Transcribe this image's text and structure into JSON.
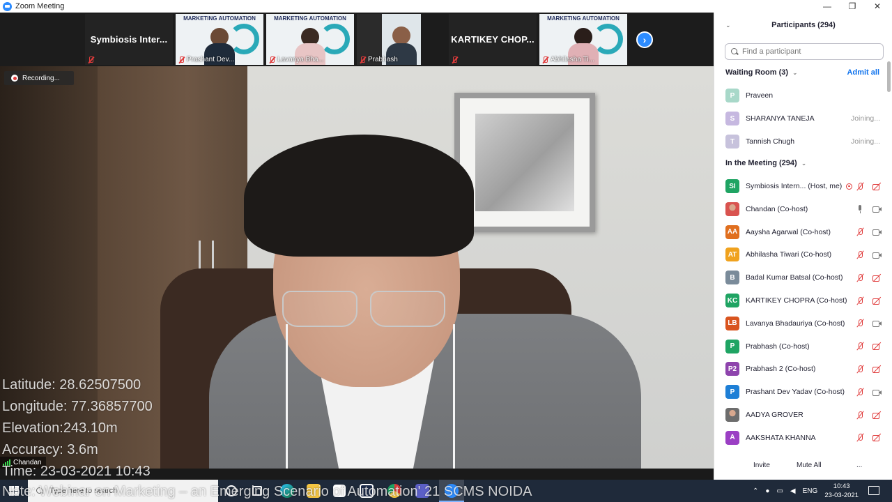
{
  "window": {
    "title": "Zoom Meeting",
    "controls": {
      "minimize": "—",
      "restore": "❐",
      "close": "✕"
    }
  },
  "strip": {
    "tiles": [
      {
        "name": "Symbiosis Inter...",
        "type": "name"
      },
      {
        "name": "Prashant Dev...",
        "type": "video",
        "poster": "MARKETING AUTOMATION"
      },
      {
        "name": "Lavanya Bha...",
        "type": "video",
        "poster": "MARKETING AUTOMATION"
      },
      {
        "name": "Prabhash",
        "type": "video",
        "poster": ""
      },
      {
        "name": "KARTIKEY CHOP...",
        "type": "name"
      },
      {
        "name": "Abhilasha Ti...",
        "type": "video",
        "poster": "MARKETING AUTOMATION"
      }
    ],
    "next_icon": "›"
  },
  "recording": {
    "label": "Recording..."
  },
  "overlay": {
    "latitude": "Latitude: 28.62507500",
    "longitude": "Longitude: 77.36857700",
    "elevation": "Elevation:243.10m",
    "accuracy": "Accuracy: 3.6m",
    "time": "Time: 23-03-2021   10:43",
    "note": "Note: Webinar on Marketing – an Emerging Scenario of Automation' 21 SCMS NOIDA"
  },
  "speaker": {
    "name": "Chandan"
  },
  "panel": {
    "title": "Participants (294)",
    "search_placeholder": "Find a participant",
    "waiting_room": "Waiting Room (3)",
    "admit_all": "Admit all",
    "in_meeting": "In the Meeting (294)",
    "waiting": [
      {
        "initials": "P",
        "name": "Praveen",
        "status": "",
        "color": "#a8d8c9"
      },
      {
        "initials": "S",
        "name": "SHARANYA TANEJA",
        "status": "Joining...",
        "color": "#c6b8e0"
      },
      {
        "initials": "T",
        "name": "Tannish Chugh",
        "status": "Joining...",
        "color": "#c7c2dc"
      }
    ],
    "participants": [
      {
        "initials": "SI",
        "name": "Symbiosis Intern...  (Host, me)",
        "color": "#1fa463",
        "mic": "muted",
        "cam": "off",
        "host": true
      },
      {
        "initials": "",
        "name": "Chandan (Co-host)",
        "color": "#d9534f",
        "mic": "on",
        "cam": "on",
        "photo": true
      },
      {
        "initials": "AA",
        "name": "Aaysha Agarwal (Co-host)",
        "color": "#e06f1f",
        "mic": "muted",
        "cam": "on"
      },
      {
        "initials": "AT",
        "name": "Abhilasha Tiwari (Co-host)",
        "color": "#f0a21e",
        "mic": "muted",
        "cam": "on"
      },
      {
        "initials": "B",
        "name": "Badal Kumar Batsal (Co-host)",
        "color": "#7a8b9a",
        "mic": "muted",
        "cam": "off"
      },
      {
        "initials": "KC",
        "name": "KARTIKEY CHOPRA (Co-host)",
        "color": "#1fa463",
        "mic": "muted",
        "cam": "off"
      },
      {
        "initials": "LB",
        "name": "Lavanya Bhadauriya (Co-host)",
        "color": "#d9541f",
        "mic": "muted",
        "cam": "on"
      },
      {
        "initials": "P",
        "name": "Prabhash (Co-host)",
        "color": "#1fa463",
        "mic": "muted",
        "cam": "off"
      },
      {
        "initials": "P2",
        "name": "Prabhash 2 (Co-host)",
        "color": "#8e44ad",
        "mic": "muted",
        "cam": "off"
      },
      {
        "initials": "P",
        "name": "Prashant Dev Yadav (Co-host)",
        "color": "#1e7fd6",
        "mic": "muted",
        "cam": "on"
      },
      {
        "initials": "",
        "name": "AADYA GROVER",
        "color": "#6d6d6d",
        "mic": "muted",
        "cam": "off",
        "photo": true
      },
      {
        "initials": "A",
        "name": "AAKSHATA KHANNA",
        "color": "#9b3fc4",
        "mic": "muted",
        "cam": "off"
      }
    ],
    "footer": {
      "invite": "Invite",
      "mute_all": "Mute All",
      "more": "..."
    }
  },
  "taskbar": {
    "search_placeholder": "Type here to search",
    "language": "ENG",
    "time": "10:43",
    "date": "23-03-2021"
  }
}
